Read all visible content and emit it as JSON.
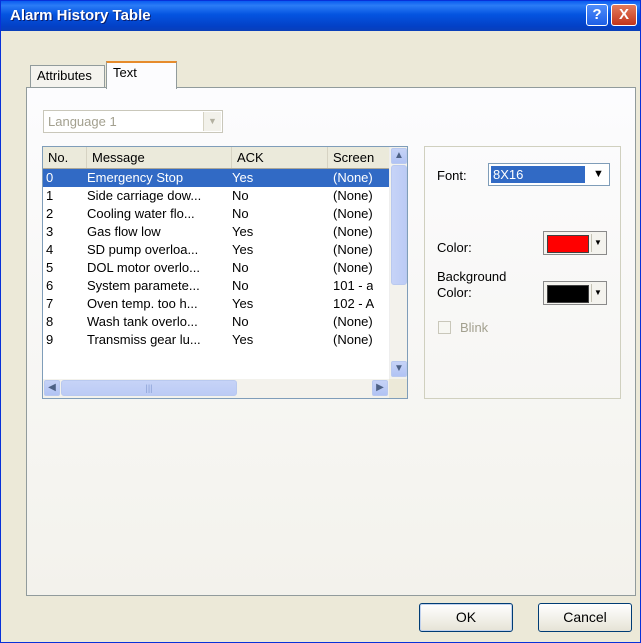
{
  "window": {
    "title": "Alarm History Table",
    "help_glyph": "?",
    "close_glyph": "X"
  },
  "tabs": [
    {
      "label": "Attributes"
    },
    {
      "label": "Text"
    }
  ],
  "language": {
    "value": "Language 1"
  },
  "grid": {
    "columns": [
      "No.",
      "Message",
      "ACK",
      "Screen"
    ],
    "rows": [
      {
        "no": "0",
        "message": "Emergency Stop",
        "ack": "Yes",
        "screen": "(None)",
        "selected": true
      },
      {
        "no": "1",
        "message": "Side carriage dow...",
        "ack": "No",
        "screen": "(None)"
      },
      {
        "no": "2",
        "message": "Cooling water flo...",
        "ack": "No",
        "screen": "(None)"
      },
      {
        "no": "3",
        "message": "Gas flow low",
        "ack": "Yes",
        "screen": "(None)"
      },
      {
        "no": "4",
        "message": "SD pump overloa...",
        "ack": "Yes",
        "screen": "(None)"
      },
      {
        "no": "5",
        "message": "DOL motor overlo...",
        "ack": "No",
        "screen": "(None)"
      },
      {
        "no": "6",
        "message": "System paramete...",
        "ack": "No",
        "screen": "101 - a"
      },
      {
        "no": "7",
        "message": "Oven temp. too h...",
        "ack": "Yes",
        "screen": "102 - A"
      },
      {
        "no": "8",
        "message": "Wash tank overlo...",
        "ack": "No",
        "screen": "(None)"
      },
      {
        "no": "9",
        "message": "Transmiss gear lu...",
        "ack": "Yes",
        "screen": "(None)"
      }
    ]
  },
  "props": {
    "font_label": "Font:",
    "font_value": "8X16",
    "color_label": "Color:",
    "color_value": "#ff0000",
    "bg_label_1": "Background",
    "bg_label_2": "Color:",
    "bg_value": "#000000",
    "blink_label": "Blink"
  },
  "buttons": {
    "ok": "OK",
    "cancel": "Cancel"
  }
}
